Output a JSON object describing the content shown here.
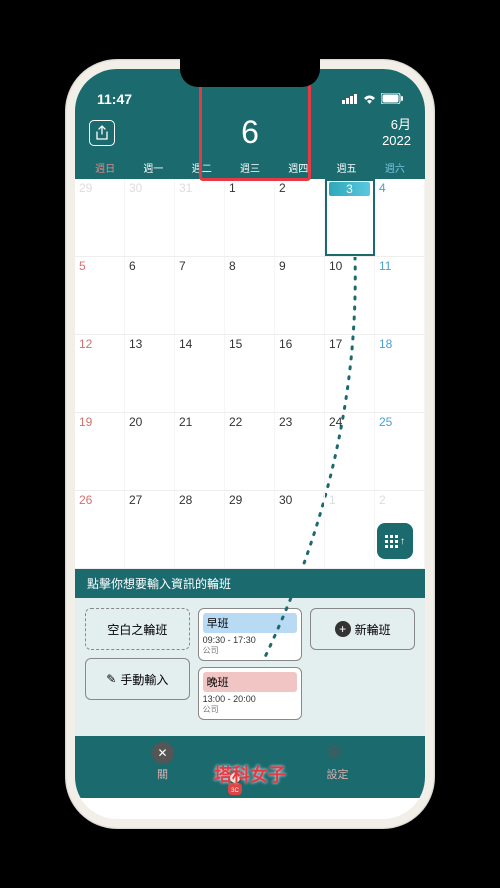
{
  "status": {
    "time": "11:47"
  },
  "header": {
    "month_num": "6",
    "month_label": "6月",
    "year": "2022"
  },
  "weekdays": [
    "週日",
    "週一",
    "週二",
    "週三",
    "週四",
    "週五",
    "週六"
  ],
  "calendar": {
    "weeks": [
      [
        {
          "n": "29",
          "cls": "prev sun"
        },
        {
          "n": "30",
          "cls": "prev"
        },
        {
          "n": "31",
          "cls": "prev"
        },
        {
          "n": "1",
          "cls": ""
        },
        {
          "n": "2",
          "cls": ""
        },
        {
          "n": "3",
          "cls": "selected"
        },
        {
          "n": "4",
          "cls": "sat"
        }
      ],
      [
        {
          "n": "5",
          "cls": "sun"
        },
        {
          "n": "6",
          "cls": ""
        },
        {
          "n": "7",
          "cls": ""
        },
        {
          "n": "8",
          "cls": ""
        },
        {
          "n": "9",
          "cls": ""
        },
        {
          "n": "10",
          "cls": ""
        },
        {
          "n": "11",
          "cls": "sat"
        }
      ],
      [
        {
          "n": "12",
          "cls": "sun"
        },
        {
          "n": "13",
          "cls": ""
        },
        {
          "n": "14",
          "cls": ""
        },
        {
          "n": "15",
          "cls": ""
        },
        {
          "n": "16",
          "cls": ""
        },
        {
          "n": "17",
          "cls": ""
        },
        {
          "n": "18",
          "cls": "sat"
        }
      ],
      [
        {
          "n": "19",
          "cls": "sun"
        },
        {
          "n": "20",
          "cls": ""
        },
        {
          "n": "21",
          "cls": ""
        },
        {
          "n": "22",
          "cls": ""
        },
        {
          "n": "23",
          "cls": ""
        },
        {
          "n": "24",
          "cls": ""
        },
        {
          "n": "25",
          "cls": "sat"
        }
      ],
      [
        {
          "n": "26",
          "cls": "sun"
        },
        {
          "n": "27",
          "cls": ""
        },
        {
          "n": "28",
          "cls": ""
        },
        {
          "n": "29",
          "cls": ""
        },
        {
          "n": "30",
          "cls": ""
        },
        {
          "n": "1",
          "cls": "prev"
        },
        {
          "n": "2",
          "cls": "prev sat"
        }
      ]
    ]
  },
  "hint": "點擊你想要輸入資訊的輪班",
  "panel": {
    "blank": "空白之輪班",
    "manual": "手動輸入",
    "new_shift": "新輪班",
    "morning": {
      "label": "早班",
      "time": "09:30 - 17:30",
      "sub": "公司"
    },
    "evening": {
      "label": "晚班",
      "time": "13:00 - 20:00",
      "sub": "公司"
    }
  },
  "footer": {
    "close": "關",
    "settings": "設定"
  },
  "watermark": "塔科女子"
}
